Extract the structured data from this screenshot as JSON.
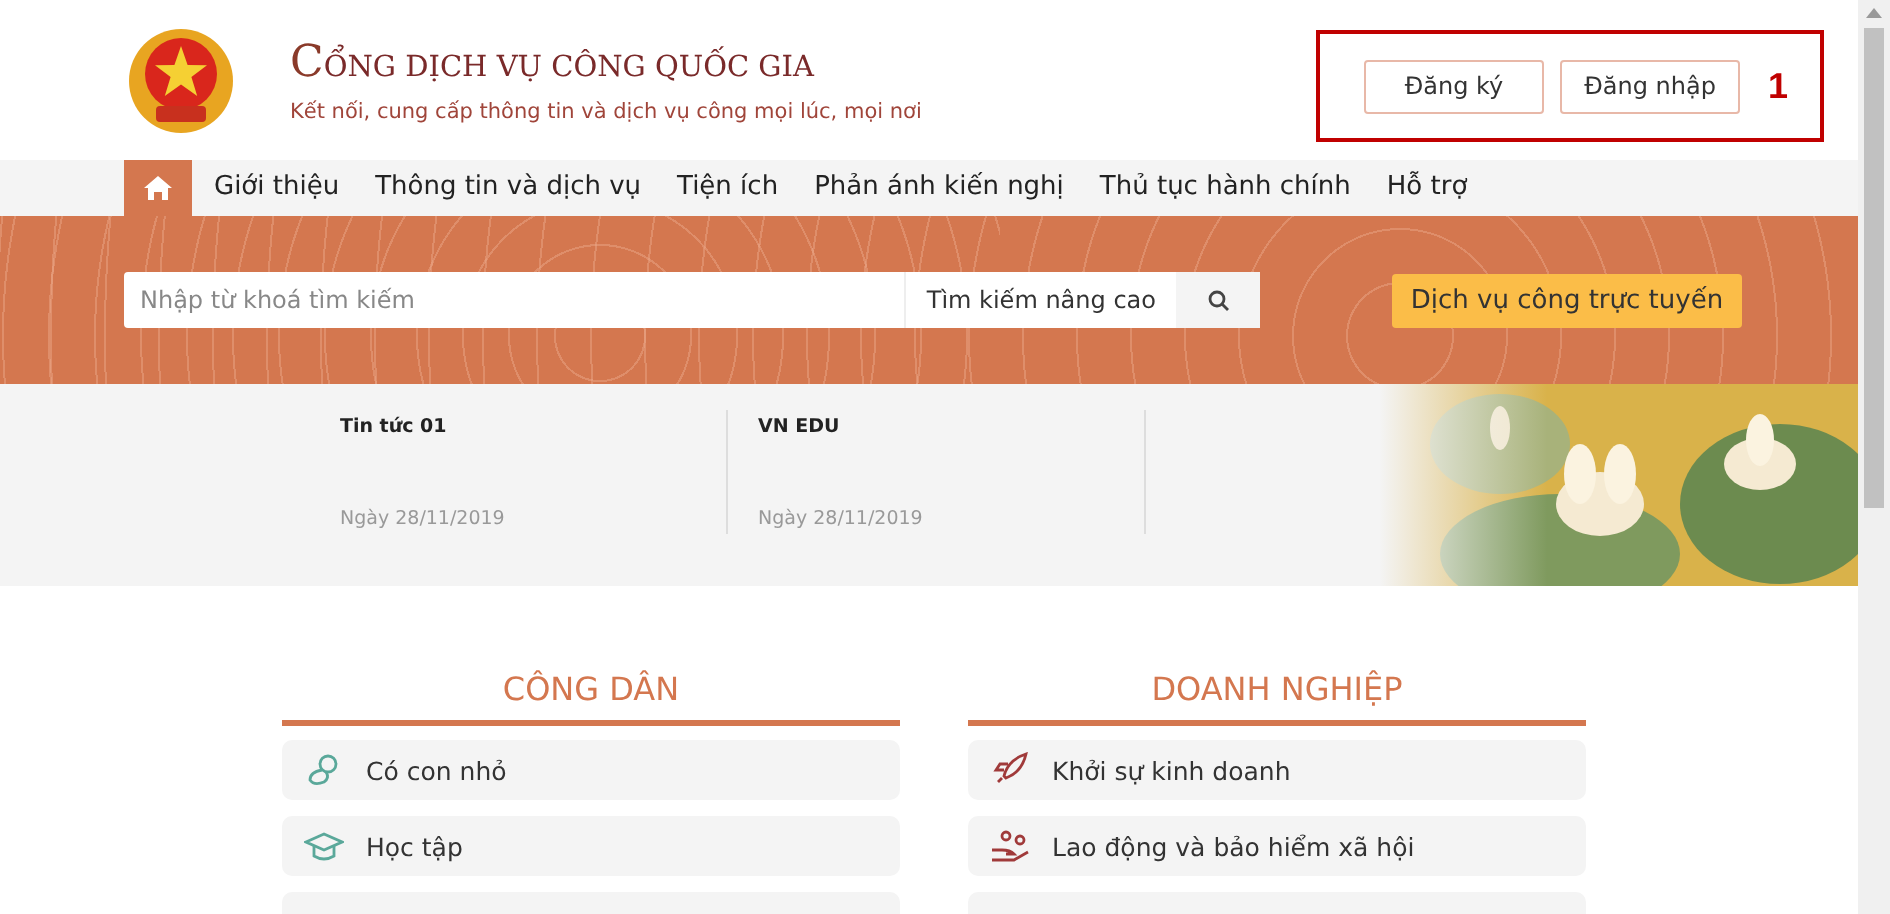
{
  "header": {
    "title": "CỔNG DỊCH VỤ CÔNG QUỐC GIA",
    "subtitle": "Kết nối, cung cấp thông tin và dịch vụ công mọi lúc, mọi nơi",
    "buttons": [
      "Đăng ký",
      "Đăng nhập"
    ],
    "annotation": "1"
  },
  "nav": {
    "items": [
      {
        "kind": "home",
        "selected": true
      },
      {
        "kind": "link",
        "label": "Giới thiệu",
        "selected": false
      },
      {
        "kind": "link",
        "label": "Thông tin và dịch vụ",
        "selected": false
      },
      {
        "kind": "link",
        "label": "Tiện ích",
        "selected": false
      },
      {
        "kind": "link",
        "label": "Phản ánh kiến nghị",
        "selected": false
      },
      {
        "kind": "link",
        "label": "Thủ tục hành chính",
        "selected": false
      },
      {
        "kind": "link",
        "label": "Hỗ trợ",
        "selected": false
      }
    ]
  },
  "search": {
    "placeholder": "Nhập từ khoá tìm kiếm",
    "advanced": "Tìm kiếm nâng cao",
    "online_button": "Dịch vụ công trực tuyến"
  },
  "news": [
    {
      "title": "Tin tức 01",
      "date": "Ngày 28/11/2019"
    },
    {
      "title": "VN EDU",
      "date": "Ngày 28/11/2019"
    }
  ],
  "sections": [
    {
      "title": "CÔNG DÂN",
      "items": [
        {
          "kind": "child",
          "label": "Có con nhỏ"
        },
        {
          "kind": "study",
          "label": "Học tập"
        },
        {
          "kind": "partial"
        }
      ]
    },
    {
      "title": "DOANH NGHIỆP",
      "items": [
        {
          "kind": "rocket",
          "label": "Khởi sự kinh doanh"
        },
        {
          "kind": "labor",
          "label": "Lao động và bảo hiểm xã hội"
        },
        {
          "kind": "partial"
        }
      ]
    }
  ]
}
